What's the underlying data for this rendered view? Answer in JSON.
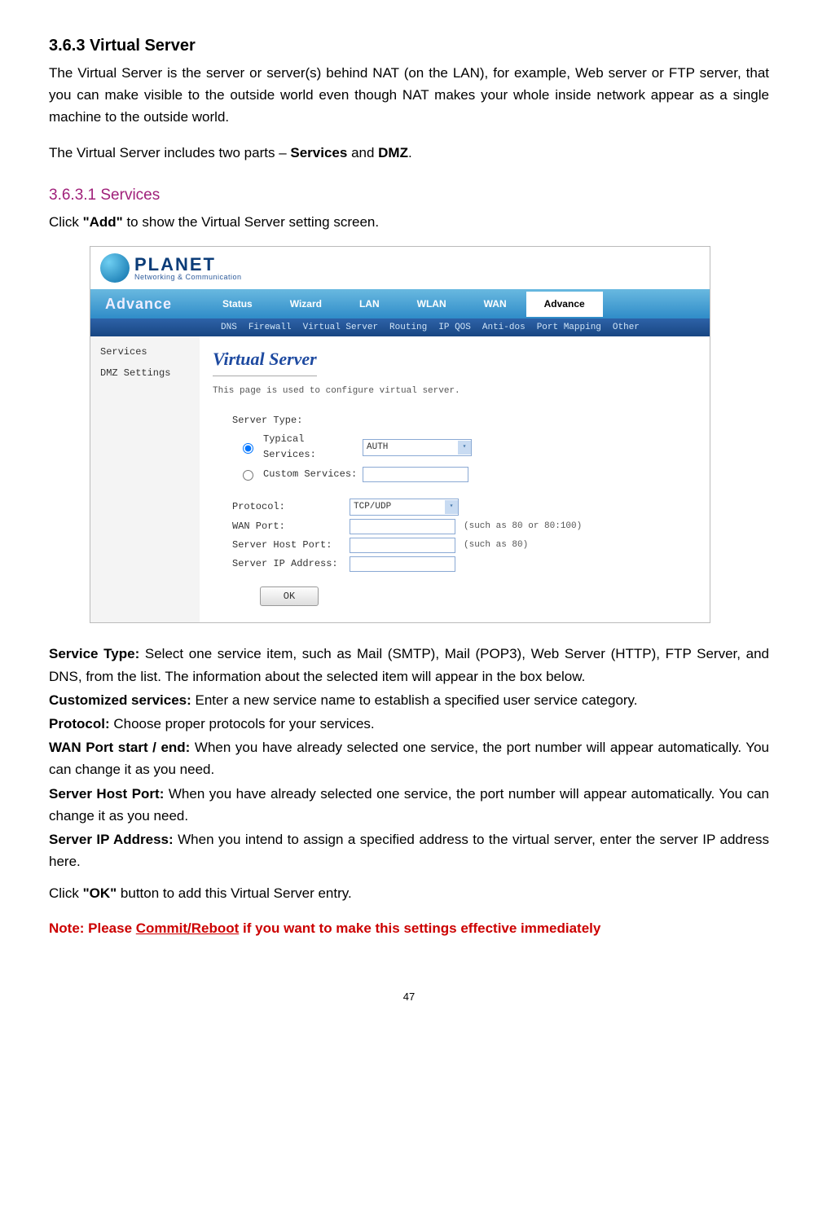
{
  "section": {
    "number_title": "3.6.3 Virtual Server",
    "p1a": "The Virtual Server is the server or server(s) behind NAT (on the LAN), for example, Web server or FTP server, that you can make visible to the outside world even though NAT makes your whole inside network appear as a single machine to the outside world.",
    "p1b_pre": "The Virtual Server includes two parts – ",
    "p1b_bold1": "Services",
    "p1b_mid": " and ",
    "p1b_bold2": "DMZ",
    "p1b_post": "."
  },
  "subsection": {
    "title": "3.6.3.1 Services",
    "intro_pre": "Click ",
    "intro_bold": "\"Add\"",
    "intro_post": " to show the Virtual Server setting screen."
  },
  "shot": {
    "brand": "PLANET",
    "brand_tag": "Networking & Communication",
    "nav_title": "Advance",
    "tabs": [
      "Status",
      "Wizard",
      "LAN",
      "WLAN",
      "WAN",
      "Advance"
    ],
    "sub_tabs": [
      "DNS",
      "Firewall",
      "Virtual Server",
      "Routing",
      "IP QOS",
      "Anti-dos",
      "Port Mapping",
      "Other"
    ],
    "side": [
      "Services",
      "DMZ Settings"
    ],
    "panel_title": "Virtual Server",
    "panel_desc": "This page is used to configure virtual server.",
    "lbl_server_type": "Server Type:",
    "lbl_typical": "Typical Services:",
    "lbl_custom": "Custom Services:",
    "val_typical": "AUTH",
    "lbl_protocol": "Protocol:",
    "val_protocol": "TCP/UDP",
    "lbl_wanport": "WAN Port:",
    "hint_wanport": "(such as 80 or 80:100)",
    "lbl_hostport": "Server Host Port:",
    "hint_hostport": "(such as 80)",
    "lbl_ip": "Server IP Address:",
    "ok": "OK"
  },
  "defs": {
    "service_type_lbl": "Service Type: ",
    "service_type_txt": "Select one service item, such as Mail (SMTP), Mail (POP3), Web Server (HTTP), FTP Server, and DNS, from the list. The information about the selected item will appear in the box below.",
    "custom_lbl": "Customized services: ",
    "custom_txt": "Enter a new service name to establish a specified user service category.",
    "protocol_lbl": "Protocol: ",
    "protocol_txt": "Choose proper protocols for your services.",
    "wanport_lbl": "WAN Port start / end: ",
    "wanport_txt": "When you have already selected one service, the port number will appear automatically. You can change it as you need.",
    "hostport_lbl": "Server Host Port: ",
    "hostport_txt": "When you have already selected one service, the port number will appear automatically. You can change it as you need.",
    "ip_lbl": "Server IP Address: ",
    "ip_txt": "When you intend to assign a specified address to the virtual server, enter the server IP address here.",
    "ok_pre": "Click ",
    "ok_bold": "\"OK\"",
    "ok_post": " button to add this Virtual Server entry."
  },
  "note": {
    "pre": "Note: Please ",
    "ul": "Commit/Reboot",
    "post": " if you want to make this settings effective immediately"
  },
  "page_number": "47"
}
